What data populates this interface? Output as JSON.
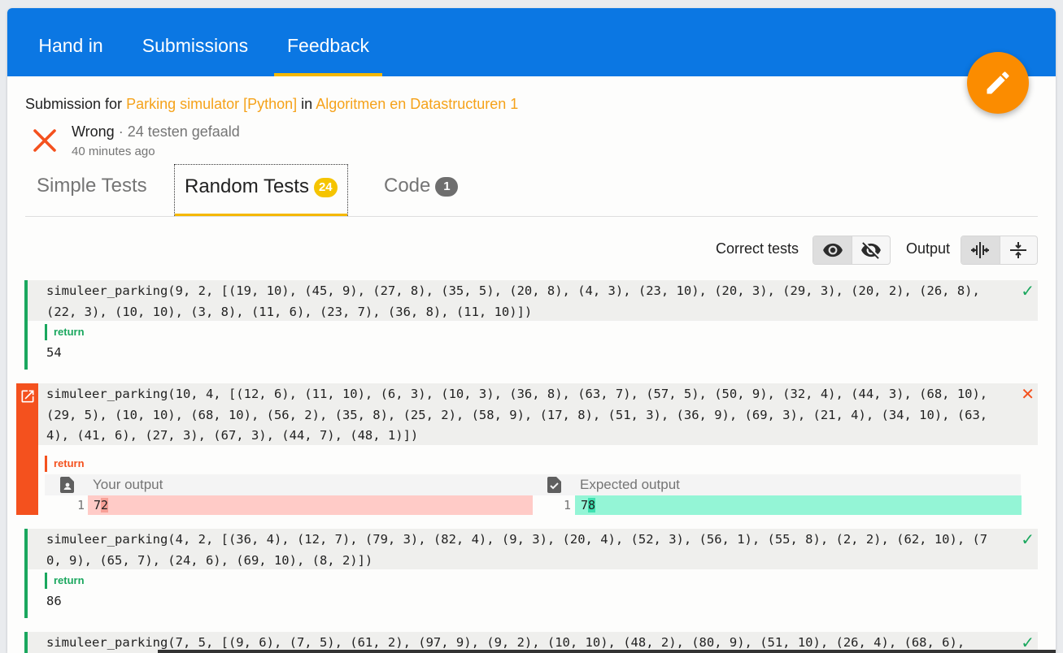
{
  "tabs": [
    {
      "label": "Hand in"
    },
    {
      "label": "Submissions"
    },
    {
      "label": "Feedback"
    }
  ],
  "submission": {
    "prefix": "Submission for ",
    "exercise": "Parking simulator [Python]",
    "in": " in ",
    "course": "Algoritmen en Datastructuren 1"
  },
  "status": {
    "result": "Wrong",
    "summary": " · 24 testen gefaald",
    "time": "40 minutes ago"
  },
  "subtabs": [
    {
      "label": "Simple Tests",
      "badge": ""
    },
    {
      "label": "Random Tests",
      "badge": "24"
    },
    {
      "label": "Code",
      "badge": "1"
    }
  ],
  "toolbar": {
    "correct_tests": "Correct tests",
    "output": "Output"
  },
  "tests": [
    {
      "code": "simuleer_parking(9, 2, [(19, 10), (45, 9), (27, 8), (35, 5), (20, 8), (4, 3), (23, 10), (20, 3), (29, 3), (20, 2), (26, 8), (22, 3), (10, 10), (3, 8), (11, 6), (23, 7), (36, 8), (11, 10)])",
      "return_label": "return",
      "value": "54",
      "mark": "✓"
    },
    {
      "code": "simuleer_parking(10, 4, [(12, 6), (11, 10), (6, 3), (10, 3), (36, 8), (63, 7), (57, 5), (50, 9), (32, 4), (44, 3), (68, 10), (29, 5), (10, 10), (68, 10), (56, 2), (35, 8), (25, 2), (58, 9), (17, 8), (51, 3), (36, 9), (69, 3), (21, 4), (34, 10), (63, 4), (41, 6), (27, 3), (67, 3), (44, 7), (48, 1)])",
      "return_label": "return",
      "your_output_label": "Your output",
      "expected_output_label": "Expected output",
      "line_no": "1",
      "your_common": "7",
      "your_diff": "2",
      "expected_common": "7",
      "expected_diff": "8",
      "mark": "✕"
    },
    {
      "code": "simuleer_parking(4, 2, [(36, 4), (12, 7), (79, 3), (82, 4), (9, 3), (20, 4), (52, 3), (56, 1), (55, 8), (2, 2), (62, 10), (70, 9), (65, 7), (24, 6), (69, 10), (8, 2)])",
      "return_label": "return",
      "value": "86",
      "mark": "✓"
    },
    {
      "code": "simuleer_parking(7, 5, [(9, 6), (7, 5), (61, 2), (97, 9), (9, 2), (10, 10), (48, 2), (80, 9), (51, 10), (26, 4), (68, 6),",
      "mark": "✓"
    }
  ],
  "colors": {
    "primary": "#0b77e3",
    "accent": "#f5b800",
    "link": "#f5a21a",
    "fab": "#fb8c00",
    "correct": "#1aa75e",
    "wrong": "#f4511e"
  }
}
